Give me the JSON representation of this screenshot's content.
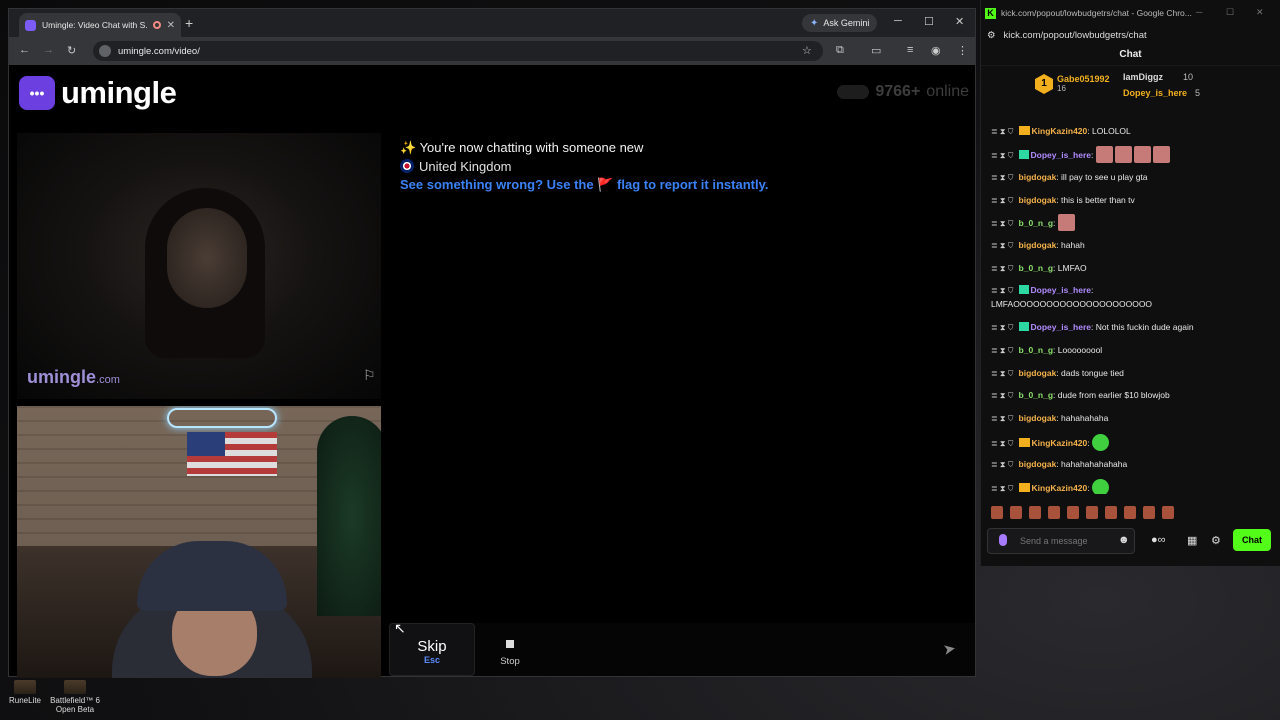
{
  "browser_left": {
    "tab_title": "Umingle: Video Chat with S...",
    "gemini_label": "Ask Gemini",
    "url": "umingle.com/video/"
  },
  "umingle": {
    "logo_text": "umingle",
    "online_count": "9766+",
    "online_label": "online",
    "watermark": "umingle",
    "watermark_suffix": ".com",
    "sys_line1": "✨ You're now chatting with someone new",
    "sys_country": "United Kingdom",
    "sys_warning_a": "See something wrong? Use the",
    "sys_warning_b": "flag to report it instantly.",
    "skip_label": "Skip",
    "skip_shortcut": "Esc",
    "stop_label": "Stop",
    "message_placeholder": ""
  },
  "chat_window": {
    "title": "kick.com/popout/lowbudgetrs/chat - Google Chro...",
    "url": "kick.com/popout/lowbudgetrs/chat",
    "header": "Chat",
    "leader1": {
      "rank": "1",
      "name": "Gabe051992",
      "count": "16"
    },
    "leader2": {
      "name": "IamDiggz",
      "count": "10"
    },
    "leader3": {
      "name": "Dopey_is_here",
      "count": "5"
    },
    "messages": [
      {
        "user": "KingKazin420",
        "text": "LOLOLOL"
      },
      {
        "user": "Dopey_is_here",
        "text": ""
      },
      {
        "user": "bigdogak",
        "text": "ill pay to see u play gta"
      },
      {
        "user": "bigdogak",
        "text": "this is better than tv"
      },
      {
        "user": "b_0_n_g",
        "text": ""
      },
      {
        "user": "bigdogak",
        "text": "hahah"
      },
      {
        "user": "b_0_n_g",
        "text": "LMFAO"
      },
      {
        "user": "Dopey_is_here",
        "text": "LMFAOOOOOOOOOOOOOOOOOOOOO"
      },
      {
        "user": "Dopey_is_here",
        "text": "Not this fuckin dude again"
      },
      {
        "user": "b_0_n_g",
        "text": "Looooooool"
      },
      {
        "user": "bigdogak",
        "text": "dads tongue tied"
      },
      {
        "user": "b_0_n_g",
        "text": "dude from earlier $10 blowjob"
      },
      {
        "user": "bigdogak",
        "text": "hahahahaha"
      },
      {
        "user": "KingKazin420",
        "text": ""
      },
      {
        "user": "bigdogak",
        "text": "hahahahahahaha"
      },
      {
        "user": "KingKazin420",
        "text": ""
      }
    ],
    "input_placeholder": "Send a message",
    "send_label": "Chat"
  },
  "desktop": {
    "icon1": "RuneLite",
    "icon2": "Battlefield™ 6 Open Beta"
  }
}
